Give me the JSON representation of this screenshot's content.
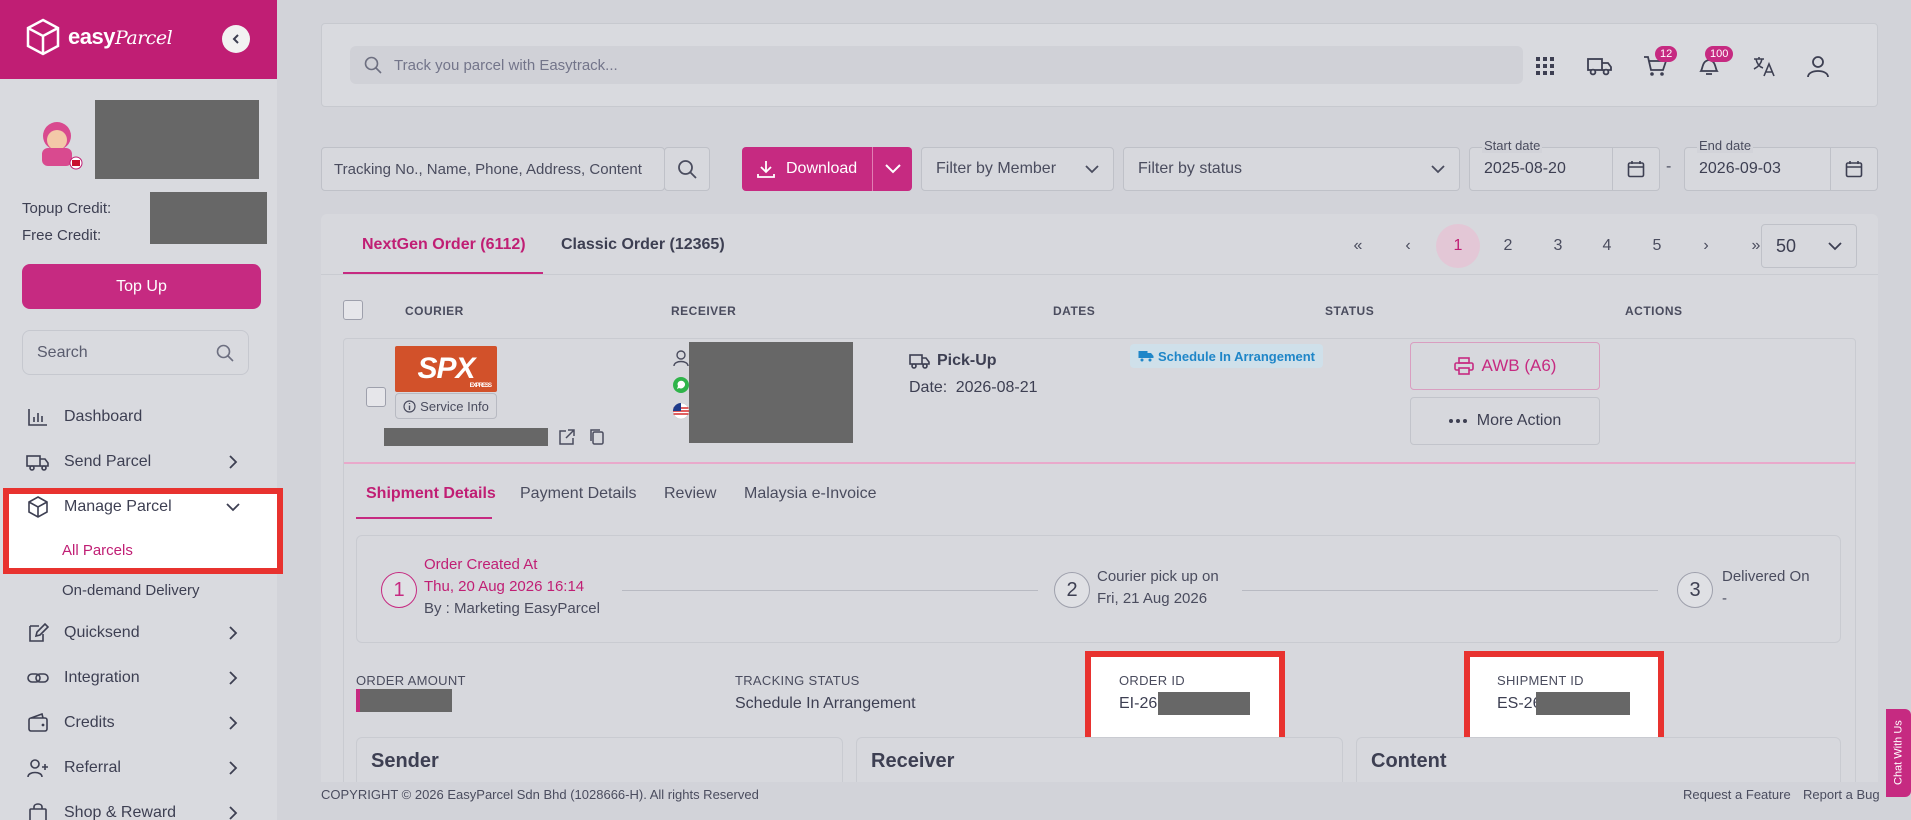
{
  "brand": {
    "name": "easy",
    "name_script": "Parcel"
  },
  "sidebar": {
    "topup_credit_label": "Topup Credit:",
    "free_credit_label": "Free Credit:",
    "topup_button": "Top Up",
    "search_placeholder": "Search",
    "items": [
      {
        "label": "Dashboard",
        "icon": "bar-chart-icon"
      },
      {
        "label": "Send Parcel",
        "icon": "truck-icon"
      },
      {
        "label": "Manage Parcel",
        "icon": "box-icon"
      },
      {
        "label": "Quicksend",
        "icon": "edit-icon"
      },
      {
        "label": "Integration",
        "icon": "link-icon"
      },
      {
        "label": "Credits",
        "icon": "wallet-icon"
      },
      {
        "label": "Referral",
        "icon": "user-plus-icon"
      },
      {
        "label": "Shop & Reward",
        "icon": "shopping-bag-icon"
      }
    ],
    "sub_items": {
      "all_parcels": "All Parcels",
      "on_demand": "On-demand Delivery"
    }
  },
  "topbar": {
    "track_placeholder": "Track you parcel with Easytrack...",
    "cart_badge": "12",
    "notification_badge": "100"
  },
  "filters": {
    "search_placeholder": "Tracking No., Name, Phone, Address, Content",
    "download_label": "Download",
    "member_placeholder": "Filter by Member",
    "status_placeholder": "Filter by status",
    "start_date_label": "Start date",
    "start_date": "2025-08-20",
    "date_separator": "-",
    "end_date_label": "End date",
    "end_date": "2026-09-03"
  },
  "tabs": {
    "nextgen": "NextGen Order (6112)",
    "classic": "Classic Order (12365)"
  },
  "pagination": {
    "first": "«",
    "prev": "‹",
    "pages": [
      "1",
      "2",
      "3",
      "4",
      "5"
    ],
    "next": "›",
    "last": "»",
    "per_page": "50"
  },
  "table": {
    "headers": {
      "courier": "COURIER",
      "receiver": "RECEIVER",
      "dates": "DATES",
      "status": "STATUS",
      "actions": "ACTIONS"
    },
    "row": {
      "courier_logo": "SPX",
      "courier_logo_sub": "EXPRESS",
      "service_info": "Service Info",
      "pickup_label": "Pick-Up",
      "date_label": "Date:",
      "date_value": "2026-08-21",
      "status": "Schedule In Arrangement",
      "awb_button": "AWB (A6)",
      "more_action": "More Action"
    }
  },
  "detail_tabs": [
    "Shipment Details",
    "Payment Details",
    "Review",
    "Malaysia e-Invoice"
  ],
  "timeline": {
    "step1": {
      "num": "1",
      "title": "Order Created At",
      "date": "Thu, 20 Aug 2026 16:14",
      "by": "By : Marketing EasyParcel"
    },
    "step2": {
      "num": "2",
      "title": "Courier pick up on",
      "date": "Fri, 21 Aug 2026"
    },
    "step3": {
      "num": "3",
      "title": "Delivered On",
      "date": "-"
    }
  },
  "info": {
    "order_amount_label": "ORDER AMOUNT",
    "tracking_status_label": "TRACKING STATUS",
    "tracking_status_value": "Schedule In Arrangement",
    "order_id_label": "ORDER ID",
    "order_id_value": "EI-26",
    "shipment_id_label": "SHIPMENT ID",
    "shipment_id_value": "ES-26"
  },
  "sections": {
    "sender": "Sender",
    "receiver": "Receiver",
    "content": "Content"
  },
  "footer": {
    "copyright": "COPYRIGHT © 2026 EasyParcel Sdn Bhd (1028666-H). All rights Reserved",
    "request_feature": "Request a Feature",
    "report_bug": "Report a Bug",
    "chat": "Chat With Us"
  },
  "colors": {
    "brand": "#c01e74",
    "accent": "#c62a81",
    "highlight": "#e8322f",
    "status_blue": "#1f86c8"
  }
}
